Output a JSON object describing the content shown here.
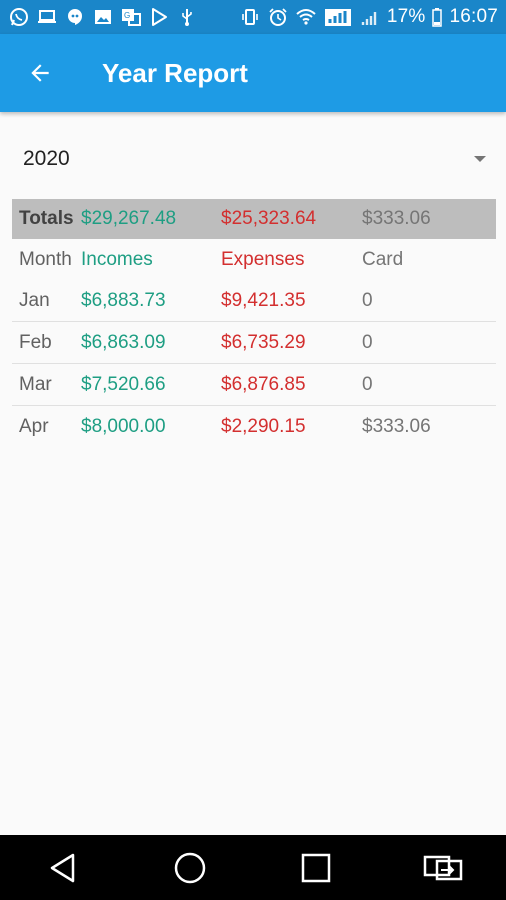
{
  "status_bar": {
    "left_icons": [
      "whatsapp-icon",
      "laptop-icon",
      "hangouts-icon",
      "image-icon",
      "translate-icon",
      "play-store-icon",
      "usb-icon"
    ],
    "right_icons": [
      "vibrate-icon",
      "alarm-icon",
      "wifi-icon",
      "signal-icon",
      "signal-weak-icon",
      "battery-icon"
    ],
    "battery_percent": "17%",
    "time": "16:07"
  },
  "app_bar": {
    "title": "Year Report",
    "back_icon": "arrow-back-icon"
  },
  "year_selector": {
    "selected": "2020"
  },
  "report": {
    "totals": {
      "label": "Totals",
      "incomes": "$29,267.48",
      "expenses": "$25,323.64",
      "card": "$333.06"
    },
    "header": {
      "month": "Month",
      "incomes": "Incomes",
      "expenses": "Expenses",
      "card": "Card"
    },
    "rows": [
      {
        "month": "Jan",
        "incomes": "$6,883.73",
        "expenses": "$9,421.35",
        "card": "0"
      },
      {
        "month": "Feb",
        "incomes": "$6,863.09",
        "expenses": "$6,735.29",
        "card": "0"
      },
      {
        "month": "Mar",
        "incomes": "$7,520.66",
        "expenses": "$6,876.85",
        "card": "0"
      },
      {
        "month": "Apr",
        "incomes": "$8,000.00",
        "expenses": "$2,290.15",
        "card": "$333.06"
      }
    ]
  },
  "colors": {
    "status_bar": "#1a86c9",
    "app_bar": "#1e9be5",
    "income": "#1e9e83",
    "expense": "#d32f2f",
    "card": "#757575",
    "totals_bg": "#bdbdbd"
  },
  "nav_bar": {
    "buttons": [
      "back-triangle-icon",
      "home-circle-icon",
      "recents-square-icon",
      "switch-app-icon"
    ]
  }
}
